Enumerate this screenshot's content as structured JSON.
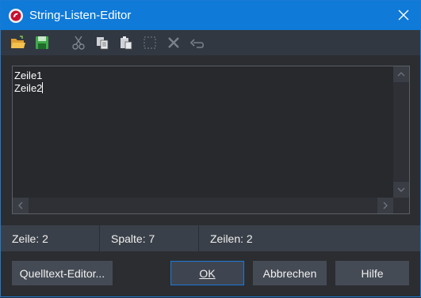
{
  "window": {
    "title": "String-Listen-Editor",
    "accent": "#0f7ad8"
  },
  "toolbar": {
    "buttons": [
      {
        "icon": "open-folder-icon",
        "enabled": true
      },
      {
        "icon": "save-icon",
        "enabled": true
      },
      {
        "icon": "cut-icon",
        "enabled": false
      },
      {
        "icon": "copy-icon",
        "enabled": true
      },
      {
        "icon": "paste-icon",
        "enabled": true
      },
      {
        "icon": "select-all-icon",
        "enabled": false
      },
      {
        "icon": "delete-icon",
        "enabled": false
      },
      {
        "icon": "undo-icon",
        "enabled": false
      }
    ]
  },
  "editor": {
    "lines": [
      "Zeile1",
      "Zeile2"
    ]
  },
  "status": {
    "line": "Zeile: 2",
    "column": "Spalte: 7",
    "lines": "Zeilen: 2"
  },
  "footer": {
    "source_editor": "Quelltext-Editor...",
    "ok": "OK",
    "cancel": "Abbrechen",
    "help": "Hilfe"
  }
}
